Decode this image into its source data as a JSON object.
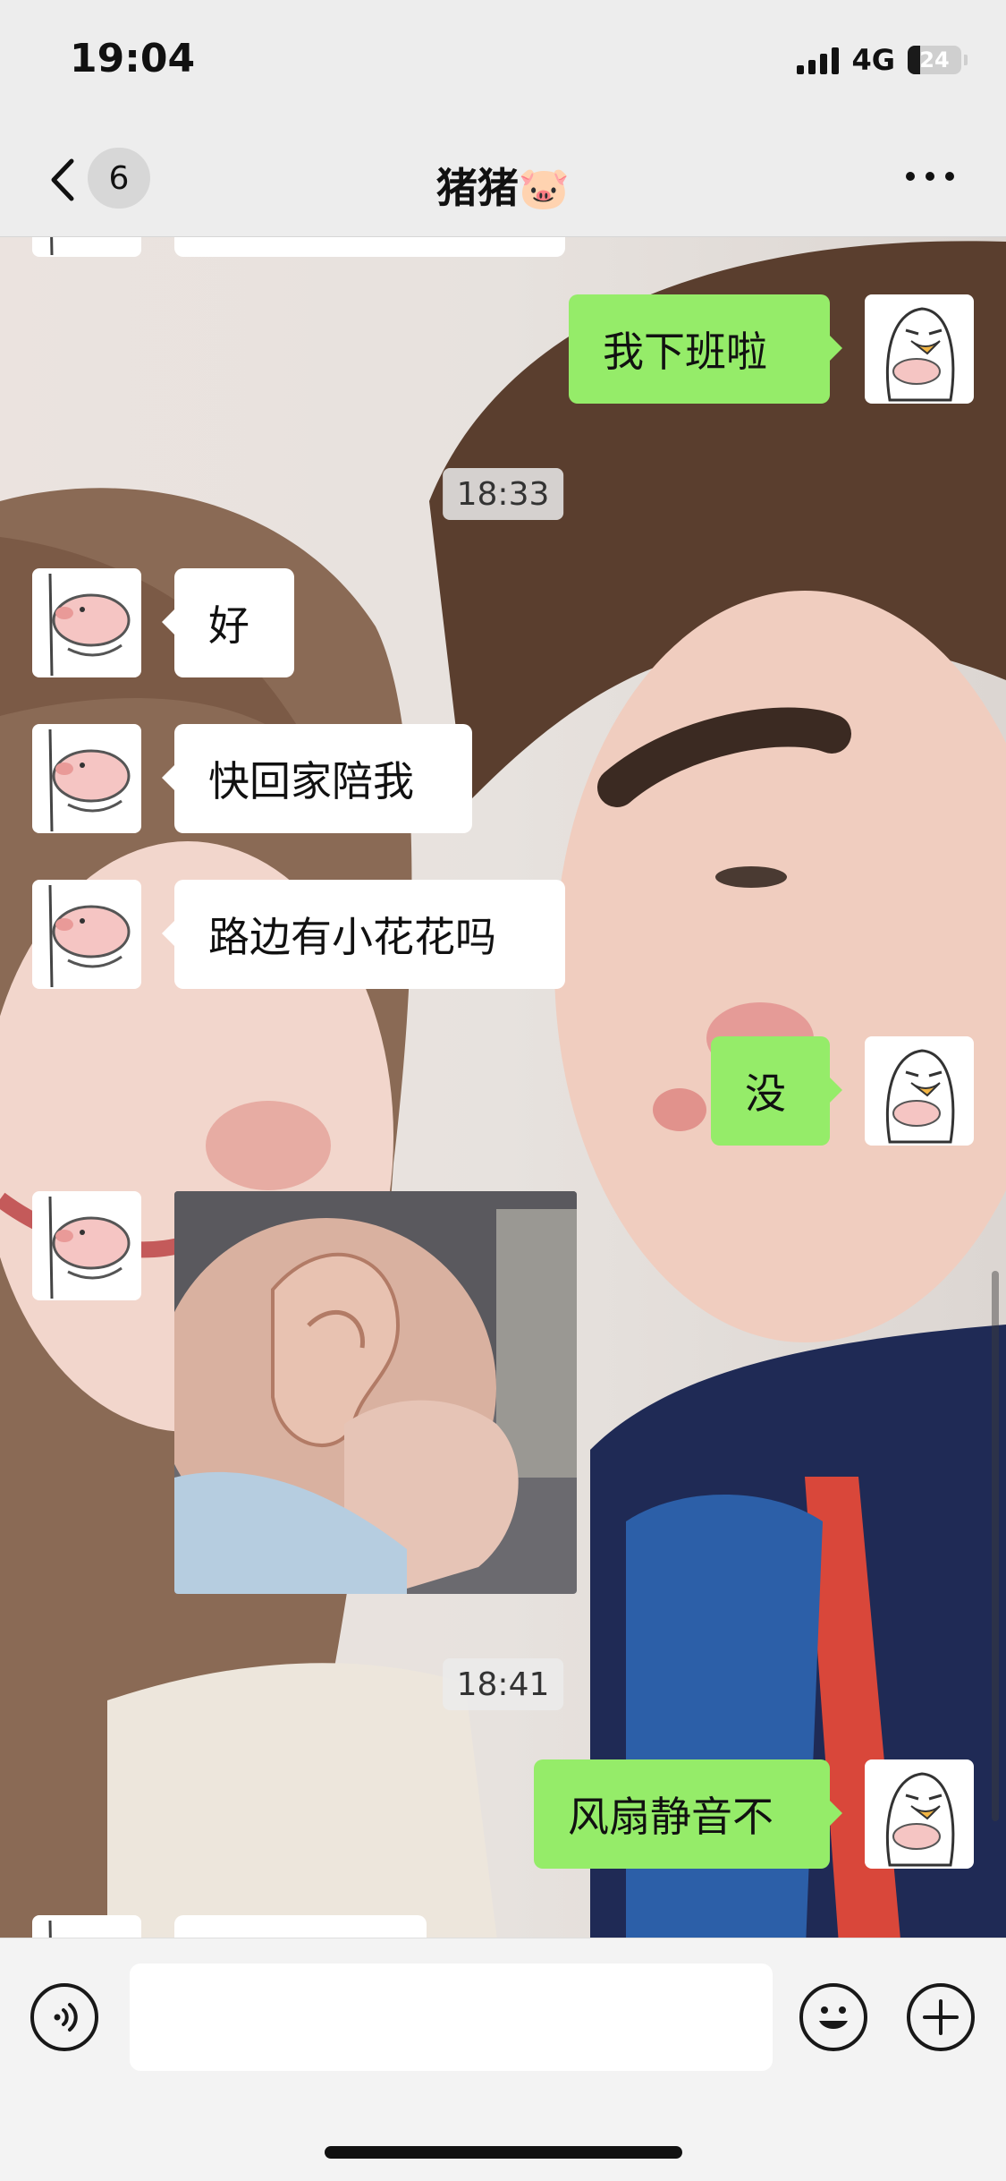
{
  "status_bar": {
    "time": "19:04",
    "network": "4G",
    "battery": "24",
    "battery_level": 0.24
  },
  "nav": {
    "unread_count": "6",
    "title": "猪猪🐷"
  },
  "messages": [
    {
      "side": "right",
      "type": "text",
      "text": "我下班啦"
    },
    {
      "type": "time",
      "text": "18:33"
    },
    {
      "side": "left",
      "type": "text",
      "text": "好"
    },
    {
      "side": "left",
      "type": "text",
      "text": "快回家陪我"
    },
    {
      "side": "left",
      "type": "text",
      "text": "路边有小花花吗"
    },
    {
      "side": "right",
      "type": "text",
      "text": "没"
    },
    {
      "side": "left",
      "type": "image",
      "text": ""
    },
    {
      "type": "time",
      "text": "18:41"
    },
    {
      "side": "right",
      "type": "text",
      "text": "风扇静音不"
    }
  ],
  "input": {
    "value": "",
    "placeholder": ""
  },
  "colors": {
    "self_bubble": "#95ec69",
    "other_bubble": "#ffffff",
    "bar_bg": "#ededed"
  },
  "icons": [
    "back-chevron-icon",
    "more-icon",
    "voice-icon",
    "emoji-icon",
    "plus-icon",
    "pig-avatar",
    "penguin-avatar"
  ]
}
